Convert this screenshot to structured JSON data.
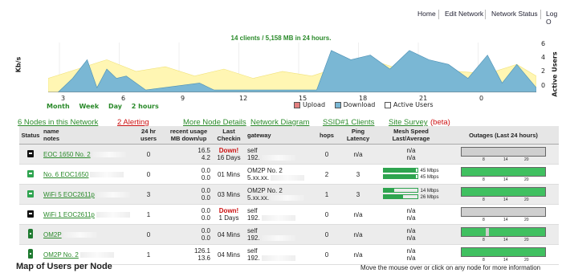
{
  "nav": [
    "Home",
    "Edit Network",
    "Network Status",
    "Log O"
  ],
  "chart": {
    "title": "14 clients / 5,158 MB in 24 hours.",
    "ylabel_left": "Kb/s",
    "ylabel_right": "Active Users",
    "yticks_right": [
      "6",
      "4",
      "2",
      "0"
    ],
    "xticks": [
      "3",
      "6",
      "9",
      "12",
      "15",
      "18",
      "21",
      "0"
    ],
    "zoom": [
      "Month",
      "Week",
      "Day",
      "2 hours"
    ],
    "legend": [
      {
        "label": "Upload",
        "color": "#e38080"
      },
      {
        "label": "Download",
        "color": "#7ab7d4"
      },
      {
        "label": "Active Users",
        "color": "#ffffff"
      }
    ]
  },
  "chart_data": {
    "type": "area",
    "title": "14 clients / 5,158 MB in 24 hours.",
    "ylabel": "Kb/s",
    "y2label": "Active Users",
    "y2lim": [
      0,
      6
    ],
    "x_ticks": [
      "3",
      "6",
      "9",
      "12",
      "15",
      "18",
      "21",
      "0"
    ],
    "series": [
      {
        "name": "Download",
        "color": "#7ab7d4",
        "points": [
          [
            0.02,
            0.0
          ],
          [
            0.05,
            0.3
          ],
          [
            0.08,
            0.7
          ],
          [
            0.1,
            0.1
          ],
          [
            0.12,
            0.5
          ],
          [
            0.14,
            0.3
          ],
          [
            0.16,
            0.35
          ],
          [
            0.2,
            0.05
          ],
          [
            0.31,
            0.2
          ],
          [
            0.34,
            0.05
          ],
          [
            0.55,
            0.05
          ],
          [
            0.58,
            0.9
          ],
          [
            0.62,
            0.7
          ],
          [
            0.66,
            0.8
          ],
          [
            0.7,
            0.5
          ],
          [
            0.74,
            0.9
          ],
          [
            0.78,
            0.7
          ],
          [
            0.82,
            0.6
          ],
          [
            0.86,
            0.3
          ],
          [
            0.9,
            0.8
          ],
          [
            0.93,
            0.2
          ],
          [
            0.96,
            0.6
          ],
          [
            1.0,
            0.1
          ]
        ]
      },
      {
        "name": "Active Users",
        "color": "#fff6b3",
        "points": [
          [
            0.0,
            0.3
          ],
          [
            0.06,
            0.5
          ],
          [
            0.12,
            0.7
          ],
          [
            0.18,
            0.45
          ],
          [
            0.24,
            0.55
          ],
          [
            0.3,
            0.35
          ],
          [
            0.36,
            0.5
          ],
          [
            0.42,
            0.3
          ],
          [
            0.48,
            0.45
          ],
          [
            0.54,
            0.35
          ],
          [
            0.6,
            0.55
          ],
          [
            0.66,
            0.7
          ],
          [
            0.72,
            0.5
          ],
          [
            0.78,
            0.6
          ],
          [
            0.84,
            0.45
          ],
          [
            0.9,
            0.4
          ],
          [
            0.96,
            0.6
          ],
          [
            1.0,
            0.35
          ]
        ]
      }
    ]
  },
  "links": {
    "nodes": "6 Nodes in this Network",
    "alerting": "2 Alerting",
    "more": "More Node Details",
    "diagram": "Network Diagram",
    "ssid": "SSID#1 Clients",
    "survey": "Site Survey",
    "beta": "(beta)"
  },
  "headers": {
    "status": "Status",
    "name": "name",
    "notes": "notes",
    "users": "24 hr users",
    "usage": "recent usage MB down/up",
    "checkin": "Last Checkin",
    "gateway": "gateway",
    "hops": "hops",
    "latency": "Ping Latency",
    "mesh": "Mesh Speed Last/Average",
    "outages": "Outages (Last 24 hours)"
  },
  "outage_ticks": [
    "8",
    "14",
    "20"
  ],
  "rows": [
    {
      "icon": "black",
      "name": "EOC 1650 No. 2",
      "users": "0",
      "down": "16.5",
      "up": "4.2",
      "status": "Down!",
      "time": "16 Days",
      "gw1": "self",
      "gw2": "192.",
      "hops": "0",
      "latency": "n/a",
      "mesh1": "n/a",
      "mesh2": "n/a",
      "outage": "down"
    },
    {
      "icon": "green",
      "name": "No. 6 EOC1650",
      "users": "0",
      "down": "0.0",
      "up": "0.0",
      "status": "",
      "time": "01 Mins",
      "gw1": "OM2P No. 2",
      "gw2": "5.xx.xx.",
      "hops": "2",
      "latency": "3",
      "mesh1": "45 Mbps",
      "mesh2": "45 Mbps",
      "mesh1v": 0.95,
      "mesh2v": 0.95,
      "outage": "up"
    },
    {
      "icon": "green",
      "name": "WiFi 5 EOC2611p",
      "users": "3",
      "down": "0.0",
      "up": "0.0",
      "status": "",
      "time": "03 Mins",
      "gw1": "OM2P No. 2",
      "gw2": "5.xx.xx.",
      "hops": "1",
      "latency": "3",
      "mesh1": "14 Mbps",
      "mesh2": "26 Mbps",
      "mesh1v": 0.3,
      "mesh2v": 0.55,
      "outage": "up"
    },
    {
      "icon": "black",
      "name": "WiFi 1 EOC2611p",
      "users": "1",
      "down": "0.0",
      "up": "0.0",
      "status": "Down!",
      "time": "1 Days",
      "gw1": "self",
      "gw2": "192.",
      "hops": "0",
      "latency": "n/a",
      "mesh1": "n/a",
      "mesh2": "n/a",
      "outage": "down"
    },
    {
      "icon": "pole",
      "name": "OM2P",
      "users": "0",
      "down": "0.0",
      "up": "0.0",
      "status": "",
      "time": "04 Mins",
      "gw1": "self",
      "gw2": "192.",
      "hops": "0",
      "latency": "n/a",
      "mesh1": "n/a",
      "mesh2": "n/a",
      "outage": "partial"
    },
    {
      "icon": "pole",
      "name": "OM2P No. 2",
      "users": "1",
      "down": "126.1",
      "up": "13.6",
      "status": "",
      "time": "04 Mins",
      "gw1": "self",
      "gw2": "192.",
      "hops": "0",
      "latency": "n/a",
      "mesh1": "n/a",
      "mesh2": "n/a",
      "outage": "up"
    }
  ],
  "map": {
    "title": "Map of Users per Node",
    "hint": "Move the mouse over or click on any node for more information"
  }
}
